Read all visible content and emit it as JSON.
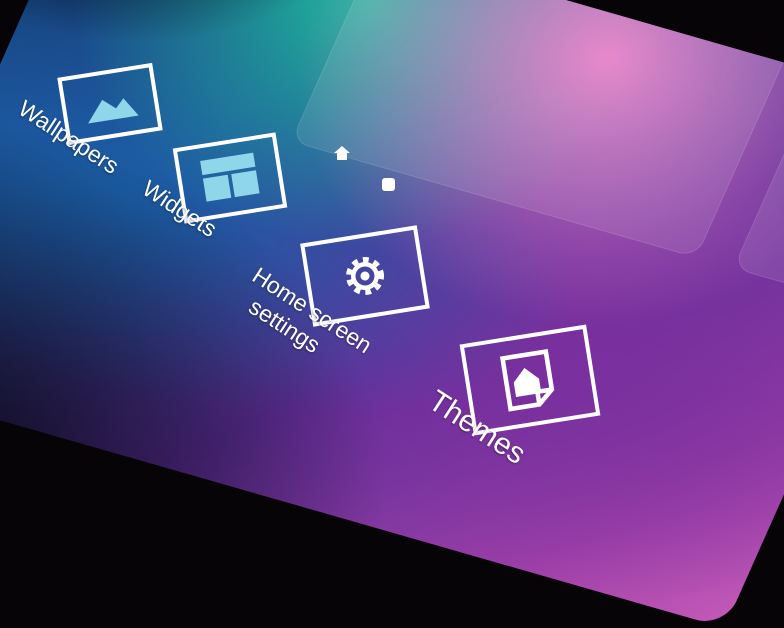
{
  "options": [
    {
      "id": "wallpapers",
      "label": "Wallpapers",
      "icon": "wallpaper-icon"
    },
    {
      "id": "widgets",
      "label": "Widgets",
      "icon": "widgets-icon"
    },
    {
      "id": "home-settings",
      "label_line1": "Home screen",
      "label_line2": "settings",
      "icon": "gear-icon"
    },
    {
      "id": "themes",
      "label": "Themes",
      "icon": "themes-icon"
    }
  ],
  "indicators": {
    "home": "home-icon",
    "current_page": "page-dot"
  },
  "colors": {
    "icon_stroke": "#ffffff",
    "wallpaper_start": "#0e3f70",
    "wallpaper_mid": "#5b2e98",
    "wallpaper_end": "#c45ab8",
    "accent_green": "#1fb99e",
    "accent_pink": "#e57cc6"
  }
}
